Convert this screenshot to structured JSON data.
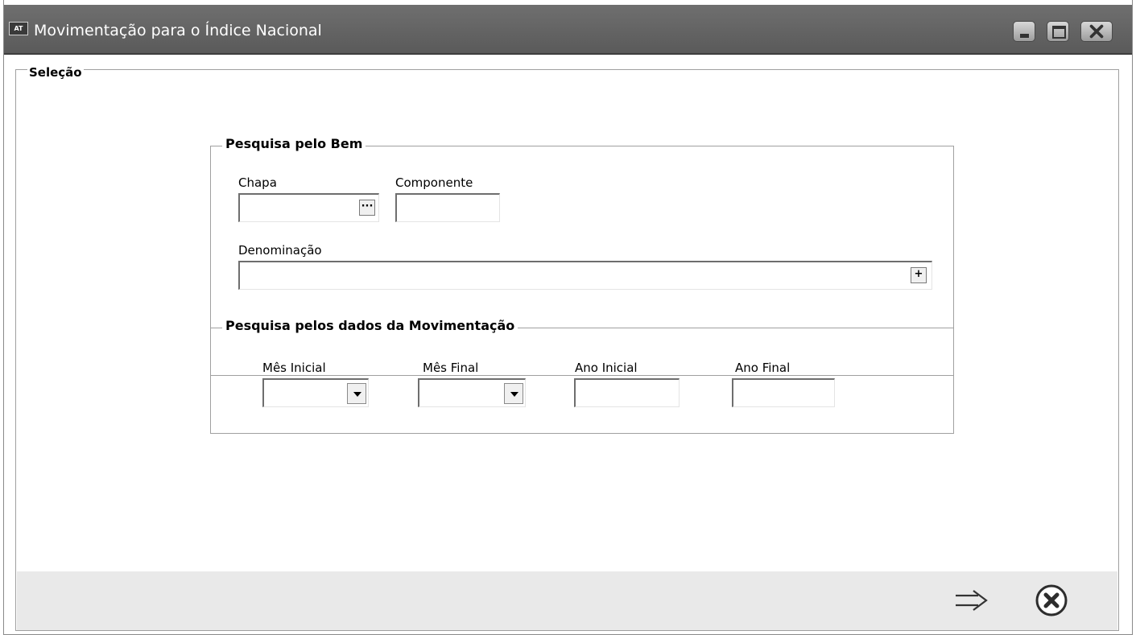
{
  "window": {
    "app_badge": "AT",
    "title": "Movimentação para o Índice Nacional"
  },
  "selecao": {
    "legend": "Seleção",
    "bem": {
      "legend": "Pesquisa pelo Bem",
      "chapa_label": "Chapa",
      "chapa_value": "",
      "chapa_button": "···",
      "componente_label": "Componente",
      "componente_value": "",
      "denominacao_label": "Denominação",
      "denominacao_value": "",
      "denominacao_button": "+"
    },
    "movimentacao": {
      "legend": "Pesquisa pelos dados da Movimentação",
      "mes_inicial_label": "Mês Inicial",
      "mes_inicial_value": "",
      "mes_final_label": "Mês Final",
      "mes_final_value": "",
      "ano_inicial_label": "Ano Inicial",
      "ano_inicial_value": "",
      "ano_final_label": "Ano Final",
      "ano_final_value": ""
    }
  },
  "footer": {
    "next_icon": "arrow-right-icon",
    "close_icon": "close-circle-icon"
  }
}
